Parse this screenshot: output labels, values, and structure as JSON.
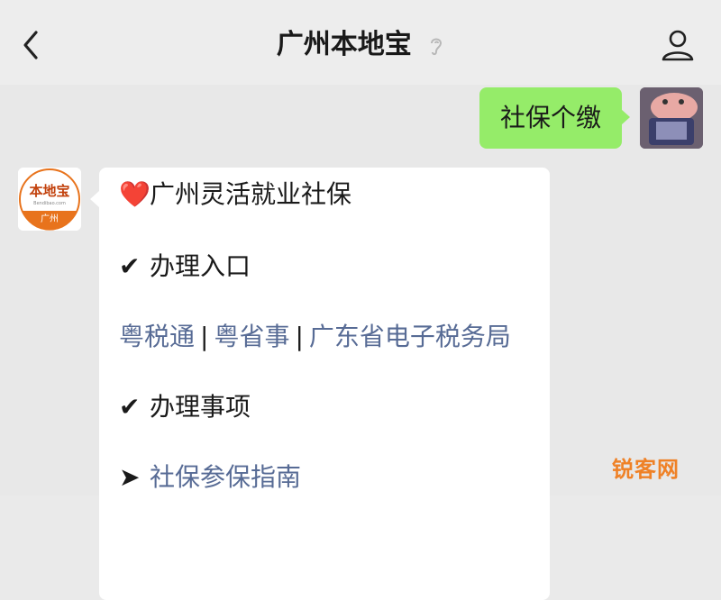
{
  "header": {
    "title": "广州本地宝",
    "back_icon": "chevron-left-icon",
    "profile_icon": "person-icon",
    "mute_icon": "ear-icon"
  },
  "messages": {
    "sent": {
      "text": "社保个缴"
    },
    "received": {
      "avatar_text": "本地宝",
      "avatar_subtext": "Bendibao.com",
      "avatar_city": "广州",
      "lines": {
        "title": {
          "icon": "❤️",
          "text": "广州灵活就业社保"
        },
        "entry": {
          "icon": "✔",
          "text": "办理入口"
        },
        "links": [
          {
            "text": "粤税通"
          },
          {
            "text": "粤省事"
          },
          {
            "text": "广东省电子税务局"
          }
        ],
        "separator": "|",
        "items": {
          "icon": "➤",
          "text": "办理事项"
        },
        "guide": {
          "icon": "➤",
          "text": "社保参保指南"
        }
      }
    }
  },
  "watermark": "锐客网",
  "colors": {
    "sent_bubble": "#95ec69",
    "link": "#576b95",
    "chat_bg": "#e8e8e8",
    "header_bg": "#ededed",
    "brand_orange": "#e8731c"
  }
}
